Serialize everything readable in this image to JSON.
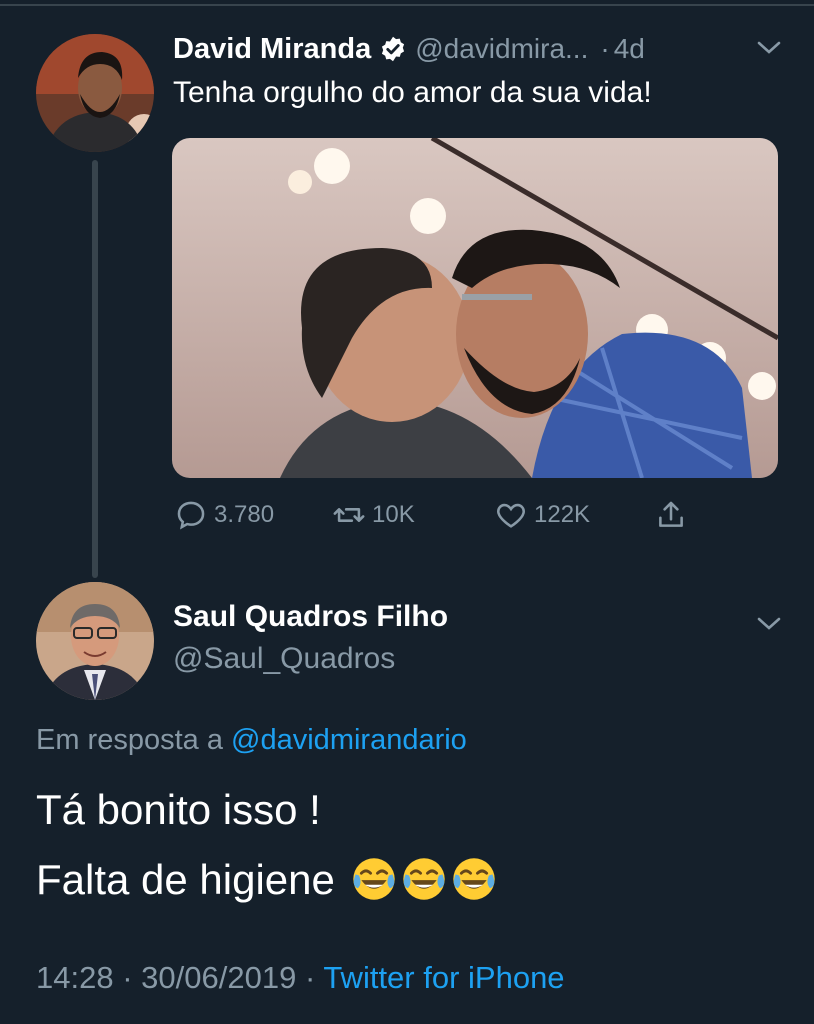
{
  "parent": {
    "name": "David Miranda",
    "handle": "@davidmira...",
    "separator": "·",
    "age": "4d",
    "text": "Tenha orgulho do amor da sua vida!",
    "replies": "3.780",
    "retweets": "10K",
    "likes": "122K"
  },
  "reply": {
    "name": "Saul Quadros Filho",
    "handle": "@Saul_Quadros",
    "in_reply_prefix": "Em resposta a",
    "in_reply_handle": "@davidmirandario",
    "line1": "Tá bonito isso !",
    "line2": "Falta de higiene",
    "time": "14:28",
    "date": "30/06/2019",
    "meta_sep": "·",
    "source": "Twitter for iPhone"
  },
  "colors": {
    "background": "#15202b",
    "muted": "#8899a6",
    "link": "#1da1f2",
    "divider": "#38444d"
  }
}
